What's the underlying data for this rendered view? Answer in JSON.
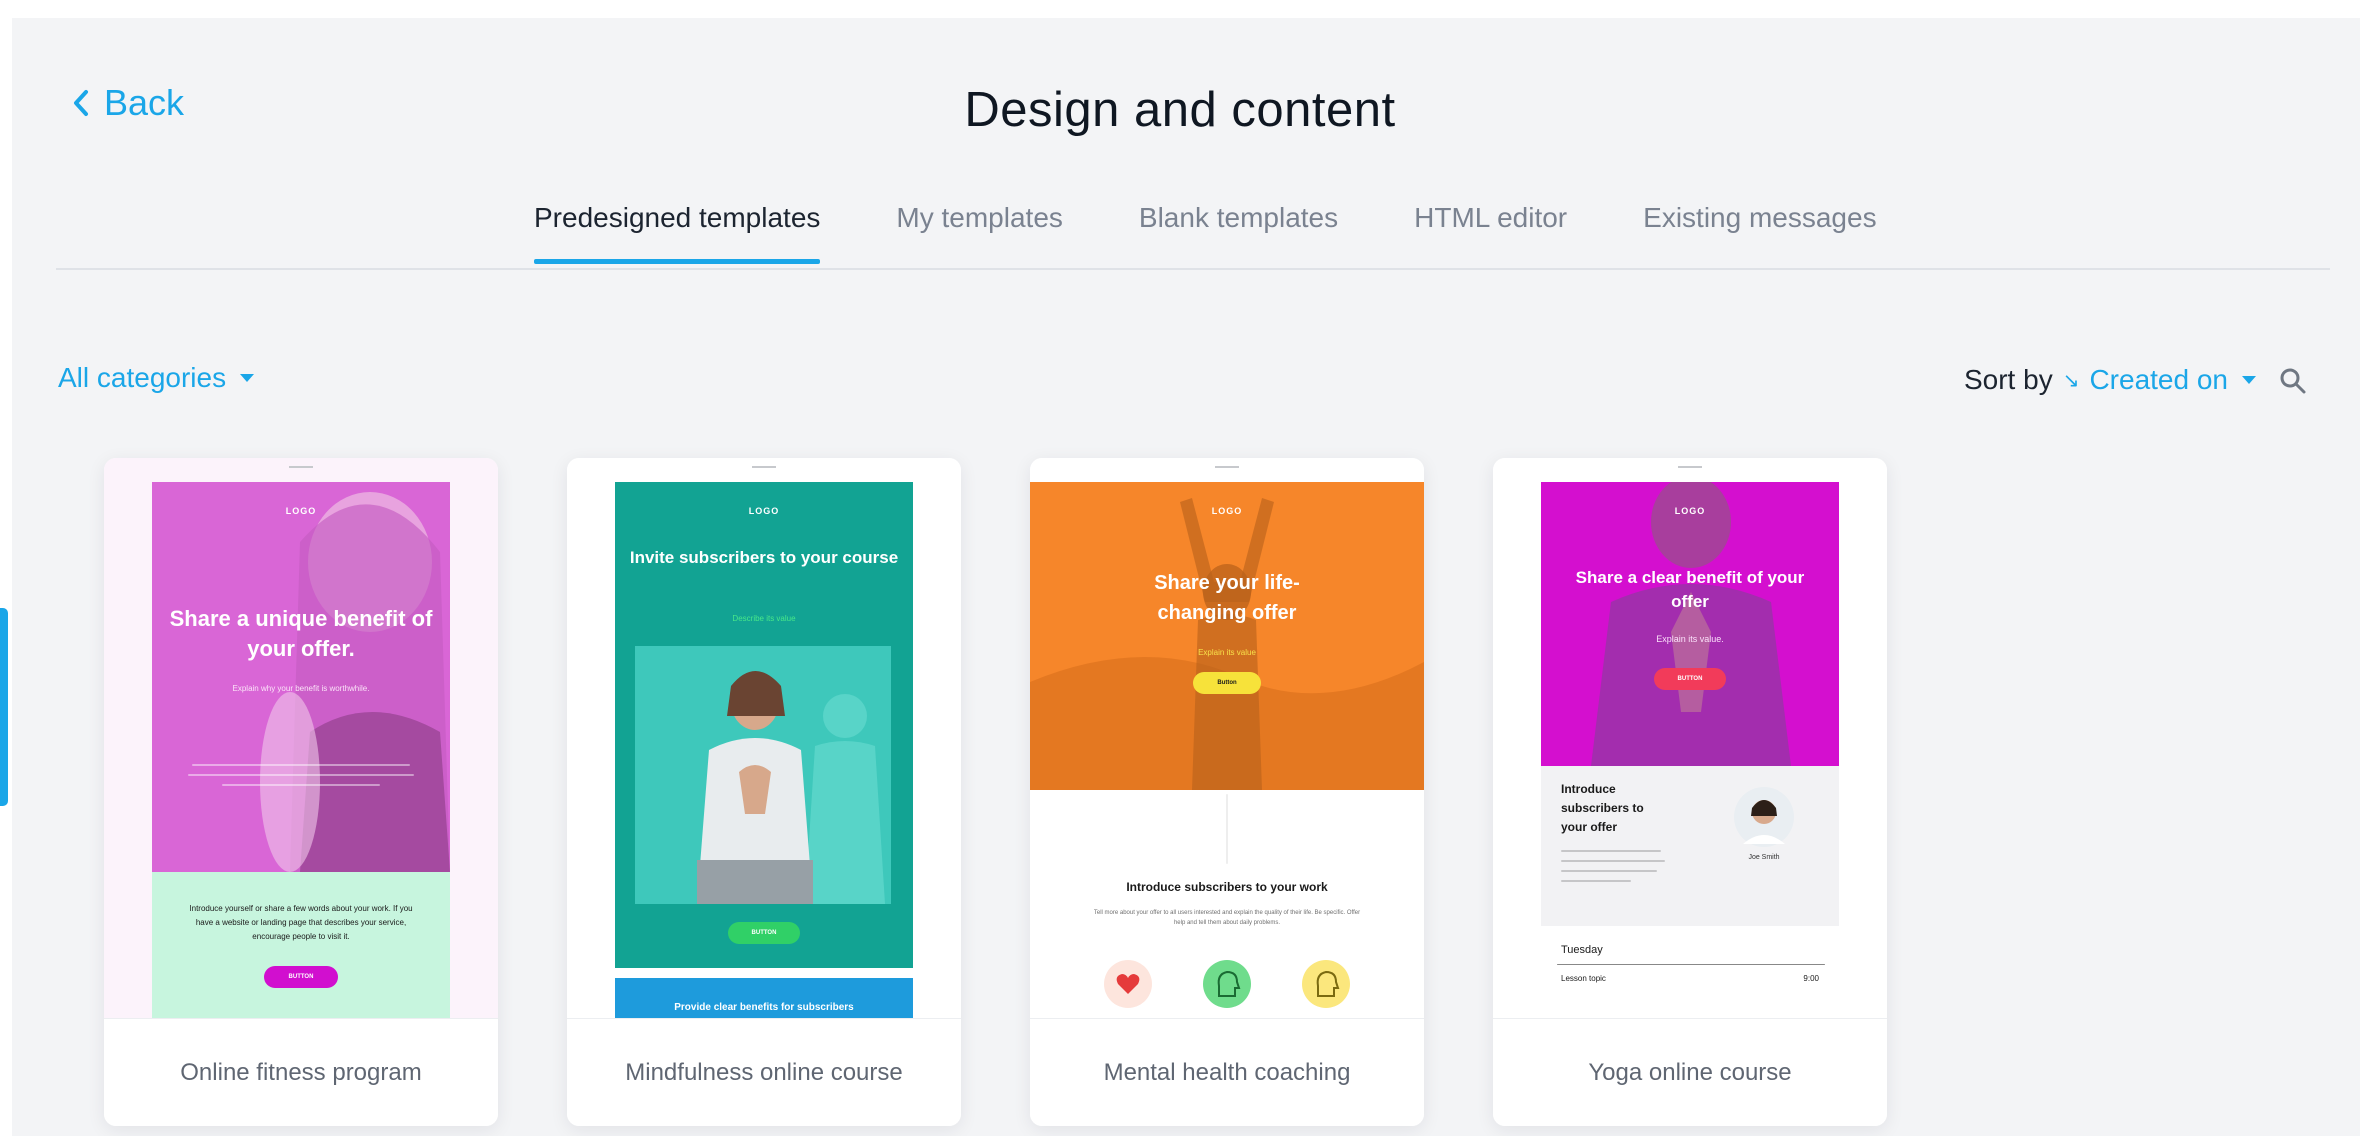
{
  "header": {
    "back_label": "Back",
    "title": "Design and content"
  },
  "tabs": [
    {
      "label": "Predesigned templates",
      "active": true
    },
    {
      "label": "My templates",
      "active": false
    },
    {
      "label": "Blank templates",
      "active": false
    },
    {
      "label": "HTML editor",
      "active": false
    },
    {
      "label": "Existing messages",
      "active": false
    }
  ],
  "filters": {
    "categories_label": "All categories",
    "sort_by_label": "Sort by",
    "sort_value": "Created on"
  },
  "colors": {
    "accent": "#1aa6e8"
  },
  "templates": [
    {
      "label": "Online fitness program",
      "logo": "LOGO",
      "headline": "Share a unique benefit of your offer.",
      "subline": "Explain why your benefit is worthwhile.",
      "body": "Introduce yourself or share a few words about your work. If you have a website or landing page that describes your service, encourage people to visit it.",
      "button": "BUTTON",
      "colors": {
        "hero": "#d966d6",
        "lower": "#c7f5de",
        "button": "#d10fcf"
      }
    },
    {
      "label": "Mindfulness online course",
      "logo": "LOGO",
      "headline": "Invite subscribers to your course",
      "subline": "Describe its value",
      "button": "BUTTON",
      "footer": "Provide clear benefits for subscribers",
      "colors": {
        "hero": "#12a393",
        "photo": "#3ec8bb",
        "button": "#30d067",
        "footer": "#1e9bdc"
      }
    },
    {
      "label": "Mental health coaching",
      "logo": "LOGO",
      "headline": "Share your life-changing offer",
      "subline": "Explain its value",
      "button": "Button",
      "section_title": "Introduce subscribers to your work",
      "section_text": "Tell more about your offer to all users interested and explain the quality of their life. Be specific. Offer help and tell them about daily problems.",
      "colors": {
        "hero": "#f6862a",
        "button": "#f7e23a"
      }
    },
    {
      "label": "Yoga online course",
      "logo": "LOGO",
      "headline": "Share a clear benefit of your offer",
      "subline": "Explain its value.",
      "button": "BUTTON",
      "intro": "Introduce subscribers to your offer",
      "person": "Joe Smith",
      "day": "Tuesday",
      "row_label": "Lesson topic",
      "row_value": "9:00",
      "colors": {
        "hero": "#d40fcf",
        "button": "#f23b5a"
      }
    }
  ]
}
